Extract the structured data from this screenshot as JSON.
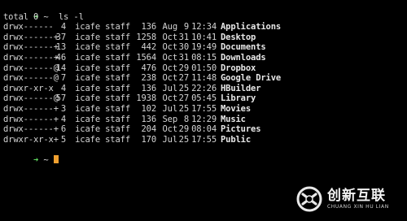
{
  "prompt": {
    "arrow": "➜",
    "dir": "~",
    "command": "ls -l"
  },
  "total_line": "total 0",
  "files": [
    {
      "perm": "drwx------",
      "links": "4",
      "owner": "icafe",
      "group": "staff",
      "size": "136",
      "month": "Aug",
      "day": "9",
      "time": "12:34",
      "name": "Applications"
    },
    {
      "perm": "drwx------+",
      "links": "37",
      "owner": "icafe",
      "group": "staff",
      "size": "1258",
      "month": "Oct",
      "day": "31",
      "time": "10:41",
      "name": "Desktop"
    },
    {
      "perm": "drwx------+",
      "links": "13",
      "owner": "icafe",
      "group": "staff",
      "size": "442",
      "month": "Oct",
      "day": "30",
      "time": "19:49",
      "name": "Documents"
    },
    {
      "perm": "drwx------+",
      "links": "46",
      "owner": "icafe",
      "group": "staff",
      "size": "1564",
      "month": "Oct",
      "day": "31",
      "time": "08:15",
      "name": "Downloads"
    },
    {
      "perm": "drwx------@",
      "links": "14",
      "owner": "icafe",
      "group": "staff",
      "size": "476",
      "month": "Oct",
      "day": "29",
      "time": "01:50",
      "name": "Dropbox"
    },
    {
      "perm": "drwx------@",
      "links": "7",
      "owner": "icafe",
      "group": "staff",
      "size": "238",
      "month": "Oct",
      "day": "27",
      "time": "11:48",
      "name": "Google Drive"
    },
    {
      "perm": "drwxr-xr-x",
      "links": "4",
      "owner": "icafe",
      "group": "staff",
      "size": "136",
      "month": "Jul",
      "day": "25",
      "time": "22:26",
      "name": "HBuilder"
    },
    {
      "perm": "drwx------@",
      "links": "57",
      "owner": "icafe",
      "group": "staff",
      "size": "1938",
      "month": "Oct",
      "day": "27",
      "time": "05:45",
      "name": "Library"
    },
    {
      "perm": "drwx------+",
      "links": "3",
      "owner": "icafe",
      "group": "staff",
      "size": "102",
      "month": "Jul",
      "day": "25",
      "time": "17:55",
      "name": "Movies"
    },
    {
      "perm": "drwx------+",
      "links": "4",
      "owner": "icafe",
      "group": "staff",
      "size": "136",
      "month": "Sep",
      "day": "8",
      "time": "12:29",
      "name": "Music"
    },
    {
      "perm": "drwx------+",
      "links": "6",
      "owner": "icafe",
      "group": "staff",
      "size": "204",
      "month": "Oct",
      "day": "29",
      "time": "08:04",
      "name": "Pictures"
    },
    {
      "perm": "drwxr-xr-x+",
      "links": "5",
      "owner": "icafe",
      "group": "staff",
      "size": "170",
      "month": "Jul",
      "day": "25",
      "time": "17:55",
      "name": "Public"
    }
  ],
  "prompt2": {
    "arrow": "➜",
    "dir": "~"
  },
  "watermark": {
    "cn": "创新互联",
    "en": "CHUANG XIN HU LIAN"
  },
  "colors": {
    "background": "#000000",
    "text": "#d4d4d4",
    "prompt_arrow": "#5fd75f",
    "cursor": "#f0a030"
  }
}
